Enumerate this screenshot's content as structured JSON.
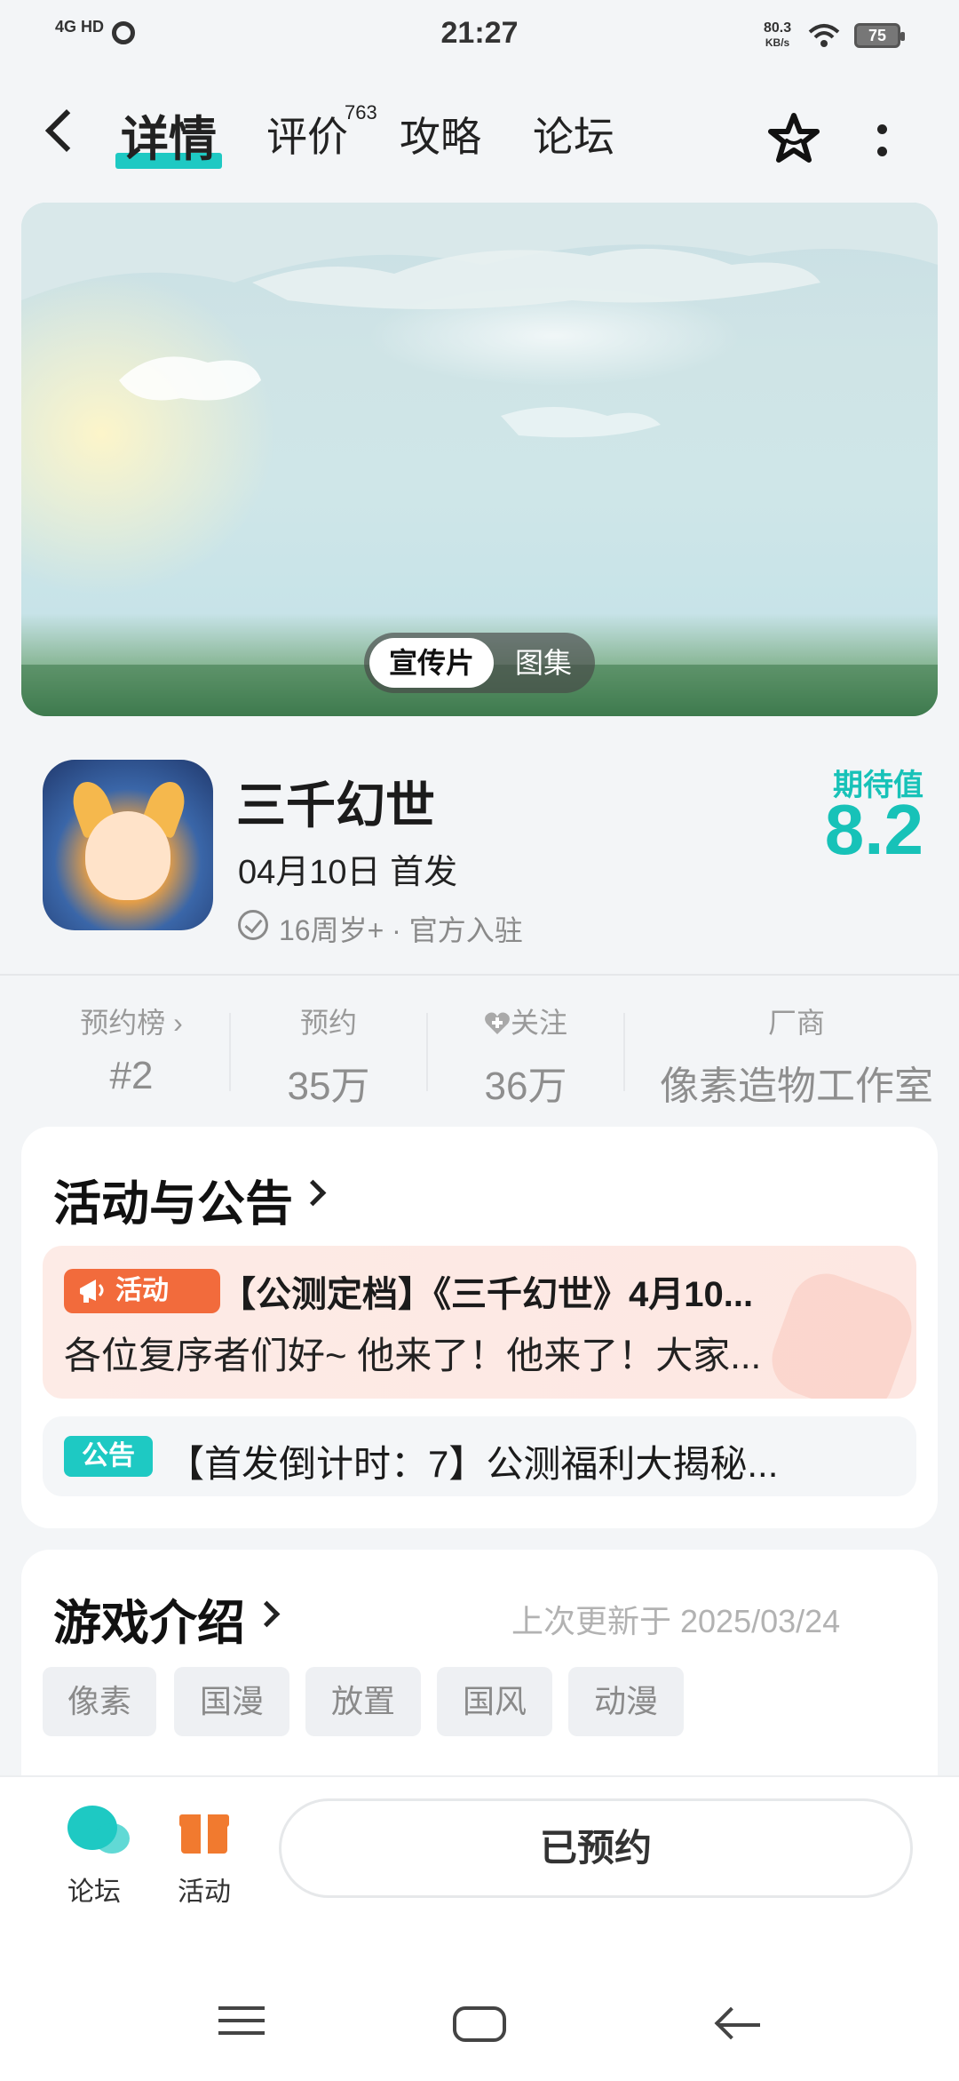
{
  "status_bar": {
    "time": "21:27",
    "network": "4G HD",
    "speed_value": "80.3",
    "speed_unit": "KB/s",
    "battery": "75"
  },
  "header": {
    "tabs": [
      {
        "label": "详情"
      },
      {
        "label": "评价",
        "count": "763"
      },
      {
        "label": "攻略"
      },
      {
        "label": "论坛"
      }
    ]
  },
  "media": {
    "segments": [
      "宣传片",
      "图集"
    ]
  },
  "game": {
    "title": "三千幻世",
    "release": "04月10日 首发",
    "meta": "16周岁+ · 官方入驻",
    "expect_label": "期待值",
    "expect_value": "8.2"
  },
  "stats": [
    {
      "label": "预约榜 ›",
      "value": "#2"
    },
    {
      "label": "预约",
      "value": "35万"
    },
    {
      "label": "关注",
      "value": "36万"
    },
    {
      "label": "厂商",
      "value": "像素造物工作室"
    }
  ],
  "announcements": {
    "title": "活动与公告",
    "activity_badge": "活动",
    "activity_title": "【公测定档】《三千幻世》4月10...",
    "activity_desc": "各位复序者们好~ 他来了！他来了！大家...",
    "notice_badge": "公告",
    "notice_title": "【首发倒计时：7】公测福利大揭秘..."
  },
  "intro": {
    "title": "游戏介绍",
    "updated": "上次更新于 2025/03/24",
    "tags": [
      "像素",
      "国漫",
      "放置",
      "国风",
      "动漫"
    ]
  },
  "bottom_bar": {
    "forum": "论坛",
    "activity": "活动",
    "reserved": "已预约"
  },
  "colors": {
    "accent": "#1ec9c3",
    "activity": "#f26b3c"
  }
}
